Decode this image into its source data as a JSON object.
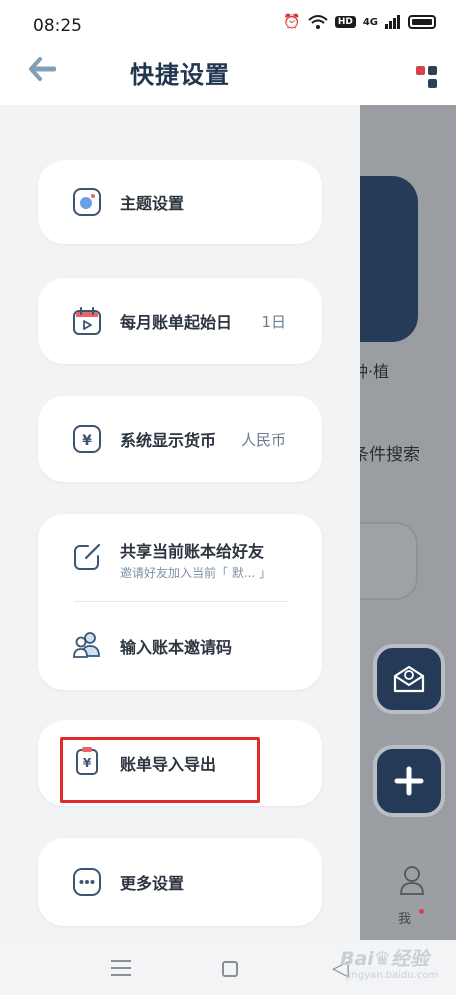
{
  "status_bar": {
    "time": "08:25",
    "hd": "HD",
    "signal": "4G"
  },
  "header": {
    "title": "快捷设置"
  },
  "menu": {
    "theme": {
      "label": "主题设置"
    },
    "month_start": {
      "label": "每月账单起始日",
      "value": "1日"
    },
    "currency": {
      "label": "系统显示货币",
      "value": "人民币"
    },
    "share": {
      "label": "共享当前账本给好友",
      "sub": "邀请好友加入当前「 默... 」"
    },
    "invite_code": {
      "label": "输入账本邀请码"
    },
    "import_export": {
      "label": "账单导入导出"
    },
    "more": {
      "label": "更多设置"
    }
  },
  "background_app": {
    "card_text": "种·植",
    "search_text": "条件搜索",
    "tab_me": "我"
  },
  "watermark": {
    "brand": "Bai♛经验",
    "url": "jingyan.baidu.com"
  },
  "colors": {
    "accent": "#23364f",
    "icon": "#3b5573",
    "highlight": "#e02a2a",
    "calendar_red": "#e8636a",
    "theme_blue": "#6aa0e6"
  }
}
